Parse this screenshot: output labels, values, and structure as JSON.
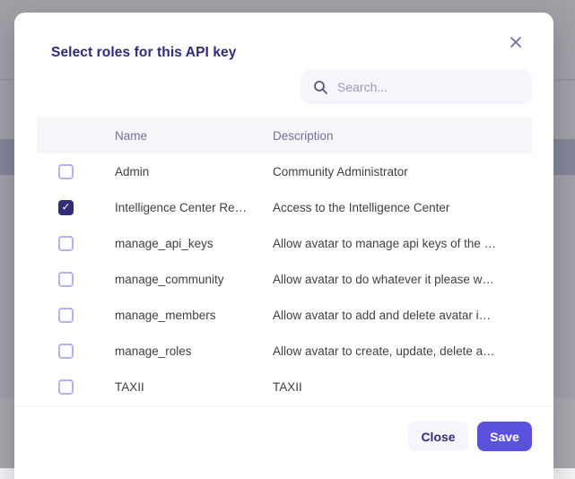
{
  "modal": {
    "title": "Select roles for this API key",
    "search": {
      "placeholder": "Search...",
      "icon": "magnifier"
    },
    "table": {
      "columns": [
        "Name",
        "Description"
      ],
      "rows": [
        {
          "name": "Admin",
          "description": "Community Administrator",
          "checked": false
        },
        {
          "name": "Intelligence Center Re…",
          "description": "Access to the Intelligence Center",
          "checked": true
        },
        {
          "name": "manage_api_keys",
          "description": "Allow avatar to manage api keys of the …",
          "checked": false
        },
        {
          "name": "manage_community",
          "description": "Allow avatar to do whatever it please w…",
          "checked": false
        },
        {
          "name": "manage_members",
          "description": "Allow avatar to add and delete avatar i…",
          "checked": false
        },
        {
          "name": "manage_roles",
          "description": "Allow avatar to create, update, delete a…",
          "checked": false
        },
        {
          "name": "TAXII",
          "description": "TAXII",
          "checked": false
        }
      ]
    },
    "footer": {
      "close_label": "Close",
      "save_label": "Save"
    }
  },
  "colors": {
    "accent": "#5a52dc",
    "title_text": "#2e2a7d",
    "checkbox_checked": "#312d78",
    "header_text": "#716f9e",
    "overlay": "rgba(62,60,70,0.45)"
  }
}
